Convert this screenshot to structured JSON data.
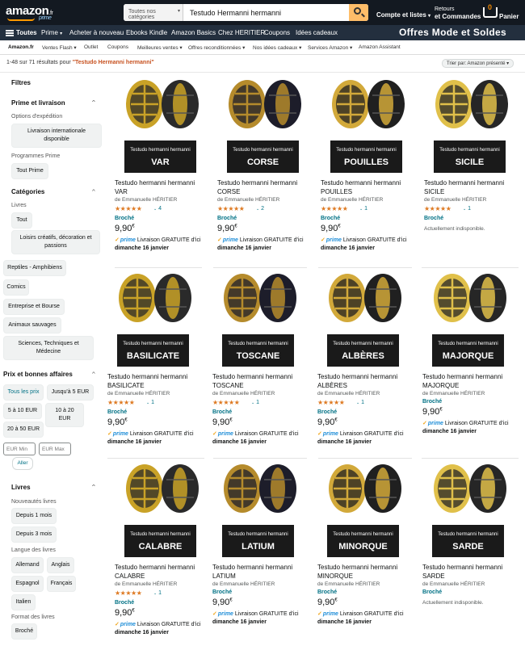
{
  "header": {
    "logo": "amazon",
    "logo_tld": ".fr",
    "logo_sub": "prime",
    "search_dept": "Toutes nos catégories",
    "search_value": "Testudo Hermanni hermanni",
    "account": "Compte et listes",
    "returns_line1": "Retours",
    "returns_line2": "et Commandes",
    "cart_count": "0",
    "cart_label": "Panier"
  },
  "nav": {
    "all": "Toutes",
    "items": [
      "Prime",
      "Acheter à nouveau",
      "Ebooks Kindle",
      "Amazon Basics",
      "Chez HERITIER",
      "Coupons",
      "Idées cadeaux"
    ],
    "promo": "Offres Mode et Soldes"
  },
  "subnav": {
    "items": [
      "Amazon.fr",
      "Ventes Flash",
      "Outlet",
      "Coupons",
      "Meilleures ventes",
      "Offres reconditionnées",
      "Nos idées cadeaux",
      "Services Amazon",
      "Amazon Assistant"
    ]
  },
  "results": {
    "count": "1-48 sur 71 résultats pour ",
    "term": "\"Testudo Hermanni hermanni\"",
    "sort": "Trier par:  Amazon présenté"
  },
  "sidebar": {
    "filters": "Filtres",
    "prime_heading": "Prime et livraison",
    "shipping_options": "Options d'expédition",
    "intl_shipping": "Livraison internationale disponible",
    "prime_programs": "Programmes Prime",
    "all_prime": "Tout Prime",
    "categories_heading": "Catégories",
    "books": "Livres",
    "all": "Tout",
    "hobbies": "Loisirs créatifs, décoration et passions",
    "reptiles": "Reptiles - Amphibiens",
    "comics": "Comics",
    "business": "Entreprise et Bourse",
    "wild_animals": "Animaux sauvages",
    "science": "Sciences, Techniques et Médecine",
    "price_heading": "Prix et bonnes affaires",
    "all_prices": "Tous les prix",
    "up_to_5": "Jusqu'à 5 EUR",
    "r5_10": "5 à 10 EUR",
    "r10_20": "10 à 20 EUR",
    "r20_50": "20 à 50 EUR",
    "min_placeholder": "EUR Min",
    "max_placeholder": "EUR Max",
    "go": "Aller",
    "books_heading": "Livres",
    "new_books": "Nouveautés livres",
    "last_month": "Depuis 1 mois",
    "last_3_months": "Depuis 3 mois",
    "language": "Langue des livres",
    "german": "Allemand",
    "english": "Anglais",
    "spanish": "Espagnol",
    "french": "Français",
    "italian": "Italien",
    "format": "Format des livres",
    "paperback": "Broché"
  },
  "common": {
    "banner_line": "Testudo hermanni hermanni",
    "title": "Testudo hermanni hermanni",
    "author": "de Emmanuelle HÉRITIER",
    "format": "Broché",
    "price_main": "9,90",
    "price_currency": "€",
    "prime": "prime",
    "shipping": " Livraison GRATUITE d'ici",
    "delivery_date": "dimanche 16 janvier",
    "unavailable": "Actuellement indisponible.",
    "stars": "★★★★★",
    "star_color": "#de7921",
    "link_color": "#007185"
  },
  "products": [
    {
      "name": "VAR",
      "rating_count": "4"
    },
    {
      "name": "CORSE",
      "rating_count": "2"
    },
    {
      "name": "POUILLES",
      "rating_count": "1"
    },
    {
      "name": "SICILE",
      "rating_count": "1"
    },
    {
      "name": "BASILICATE",
      "rating_count": "1"
    },
    {
      "name": "TOSCANE",
      "rating_count": "1"
    },
    {
      "name": "ALBÈRES",
      "rating_count": "1"
    },
    {
      "name": "MAJORQUE",
      "rating_count": ""
    },
    {
      "name": "CALABRE",
      "rating_count": "1"
    },
    {
      "name": "LATIUM",
      "rating_count": ""
    },
    {
      "name": "MINORQUE",
      "rating_count": ""
    },
    {
      "name": "SARDE",
      "rating_count": ""
    }
  ]
}
